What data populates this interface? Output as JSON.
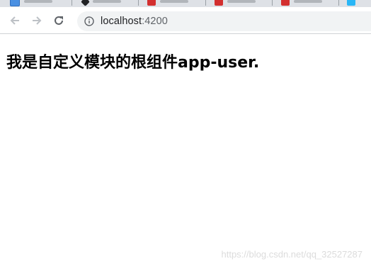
{
  "tabs": [
    {
      "favicon": "blue-favicon-icon"
    },
    {
      "favicon": "black-diamond-favicon-icon"
    },
    {
      "favicon": "red-favicon-icon"
    },
    {
      "favicon": "red-favicon-icon"
    },
    {
      "favicon": "red-favicon-icon"
    },
    {
      "favicon": "cyan-favicon-icon"
    }
  ],
  "toolbar": {
    "back_icon": "arrow-left-icon",
    "forward_icon": "arrow-right-icon",
    "reload_icon": "reload-icon",
    "info_icon": "info-circle-icon",
    "url_host": "localhost",
    "url_port": ":4200"
  },
  "page": {
    "heading": "我是自定义模块的根组件app-user."
  },
  "watermark": "https://blog.csdn.net/qq_32527287",
  "colors": {
    "tabstrip": "#dee1e6",
    "omnibox": "#f1f3f4",
    "text": "#000000",
    "watermark": "#dcdcdc"
  }
}
